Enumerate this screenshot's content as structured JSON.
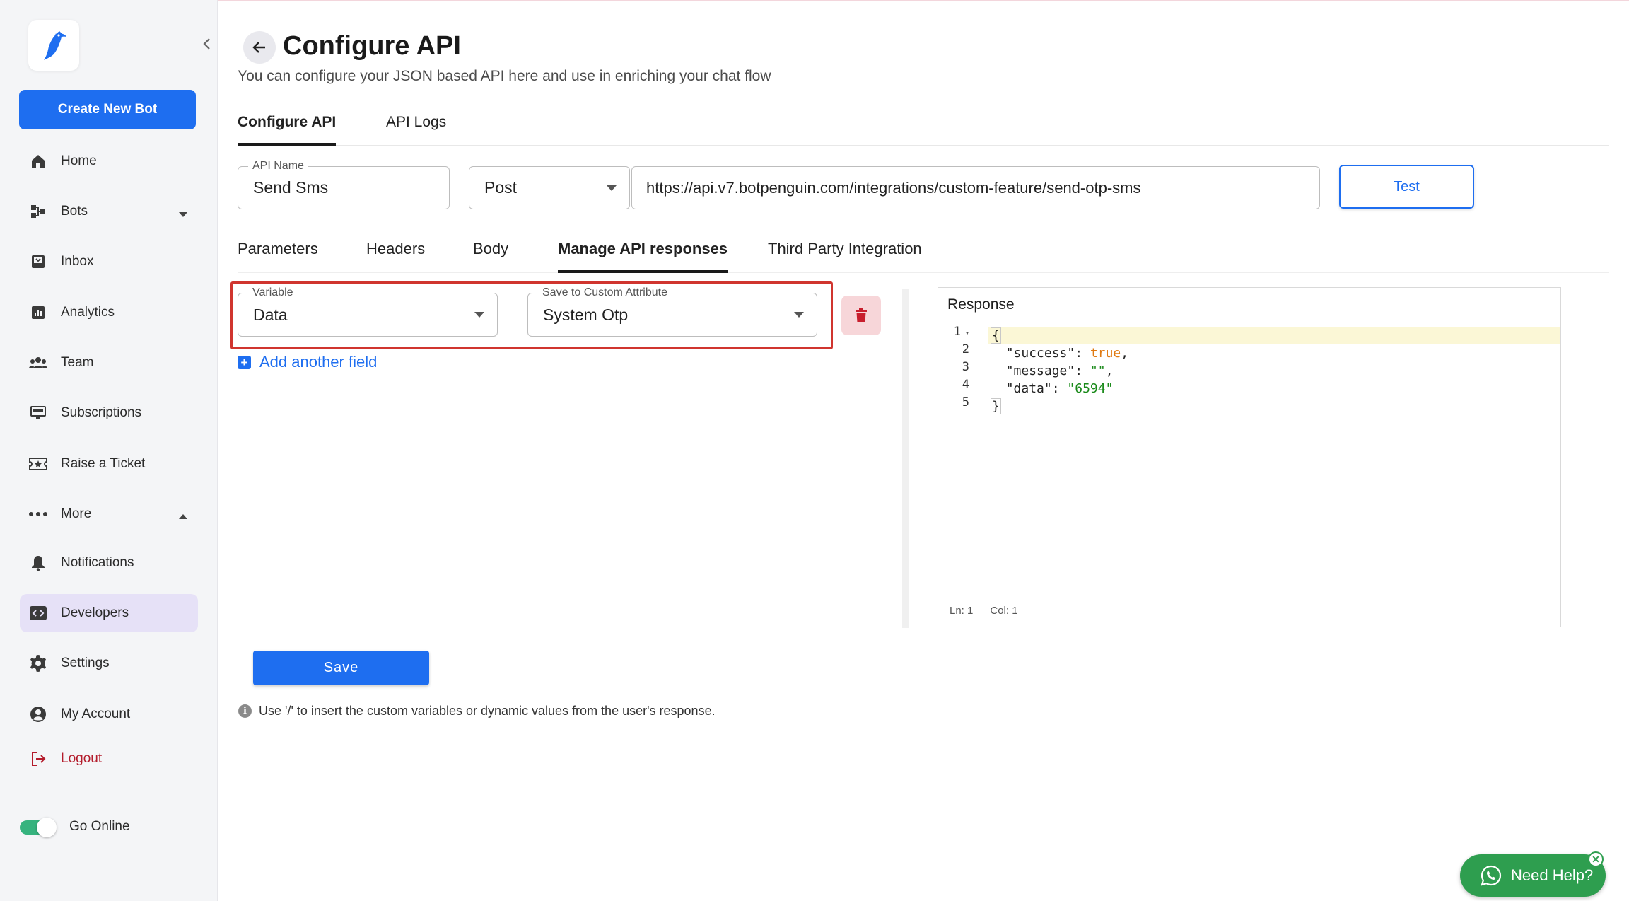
{
  "sidebar": {
    "create_button": "Create New Bot",
    "items": [
      {
        "label": "Home",
        "icon": "home-icon"
      },
      {
        "label": "Bots",
        "icon": "bots-icon"
      },
      {
        "label": "Inbox",
        "icon": "inbox-icon"
      },
      {
        "label": "Analytics",
        "icon": "analytics-icon"
      },
      {
        "label": "Team",
        "icon": "team-icon"
      },
      {
        "label": "Subscriptions",
        "icon": "subscriptions-icon"
      },
      {
        "label": "Raise a Ticket",
        "icon": "ticket-icon"
      },
      {
        "label": "More",
        "icon": "more-icon"
      },
      {
        "label": "Notifications",
        "icon": "bell-icon"
      },
      {
        "label": "Developers",
        "icon": "code-icon",
        "active": true
      },
      {
        "label": "Settings",
        "icon": "gear-icon"
      },
      {
        "label": "My Account",
        "icon": "account-icon"
      },
      {
        "label": "Logout",
        "icon": "logout-icon"
      }
    ],
    "online_toggle": {
      "label": "Go Online",
      "on": true
    }
  },
  "header": {
    "title": "Configure API",
    "subtitle": "You can configure your JSON based API here and use in enriching your chat flow"
  },
  "top_tabs": [
    "Configure API",
    "API Logs"
  ],
  "api": {
    "name_label": "API Name",
    "name_value": "Send Sms",
    "method": "Post",
    "url": "https://api.v7.botpenguin.com/integrations/custom-feature/send-otp-sms",
    "test_button": "Test"
  },
  "sub_tabs": [
    "Parameters",
    "Headers",
    "Body",
    "Manage API responses",
    "Third Party Integration"
  ],
  "mapping": {
    "variable_label": "Variable",
    "variable_value": "Data",
    "attribute_label": "Save to Custom Attribute",
    "attribute_value": "System Otp",
    "add_field": "Add another field"
  },
  "response": {
    "title": "Response",
    "line_numbers": [
      "1",
      "2",
      "3",
      "4",
      "5"
    ],
    "code": {
      "open": "{",
      "success_key": "\"success\"",
      "success_val": "true",
      "message_key": "\"message\"",
      "message_val": "\"\"",
      "data_key": "\"data\"",
      "data_val": "\"6594\"",
      "close": "}"
    },
    "status_ln": "Ln: 1",
    "status_col": "Col: 1"
  },
  "save_button": "Save",
  "info_note": "Use '/' to insert the custom variables or dynamic values from the user's response.",
  "help_button": "Need Help?",
  "colors": {
    "primary": "#1e6ef0",
    "highlight": "#d0352f",
    "whatsapp": "#2e9e4f",
    "active_nav": "#e6e1f7"
  }
}
